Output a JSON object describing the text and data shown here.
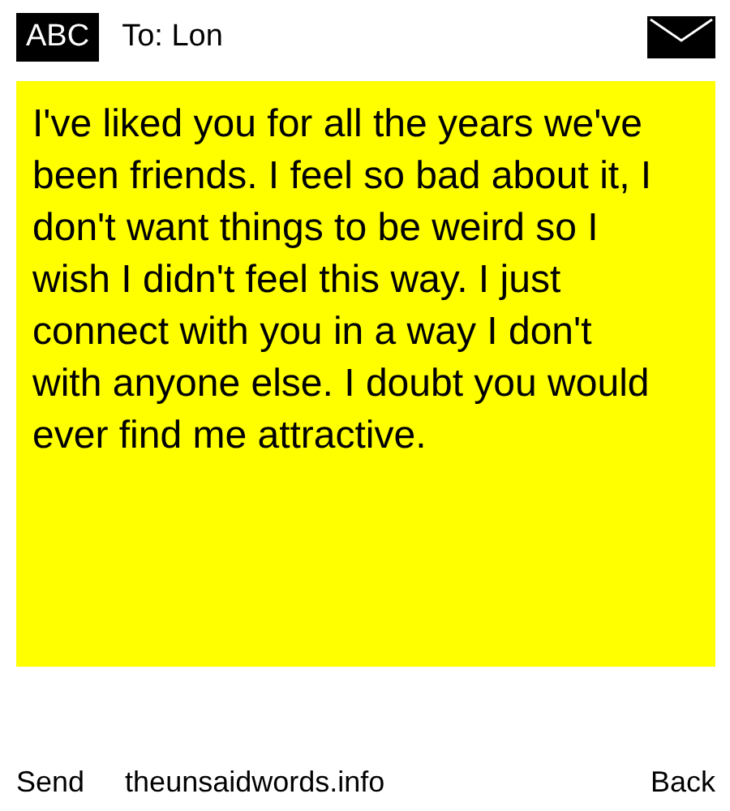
{
  "header": {
    "keyboard_mode": "ABC",
    "recipient": "To: Lon"
  },
  "message": {
    "body": "I've liked you for all the years we've been friends. I feel so bad about it, I don't want things to be weird so I wish I didn't feel this way. I just connect with you in a way I don't with anyone else. I doubt you would ever find me attractive."
  },
  "footer": {
    "left_button": "Send",
    "site": "theunsaidwords.info",
    "right_button": "Back"
  }
}
